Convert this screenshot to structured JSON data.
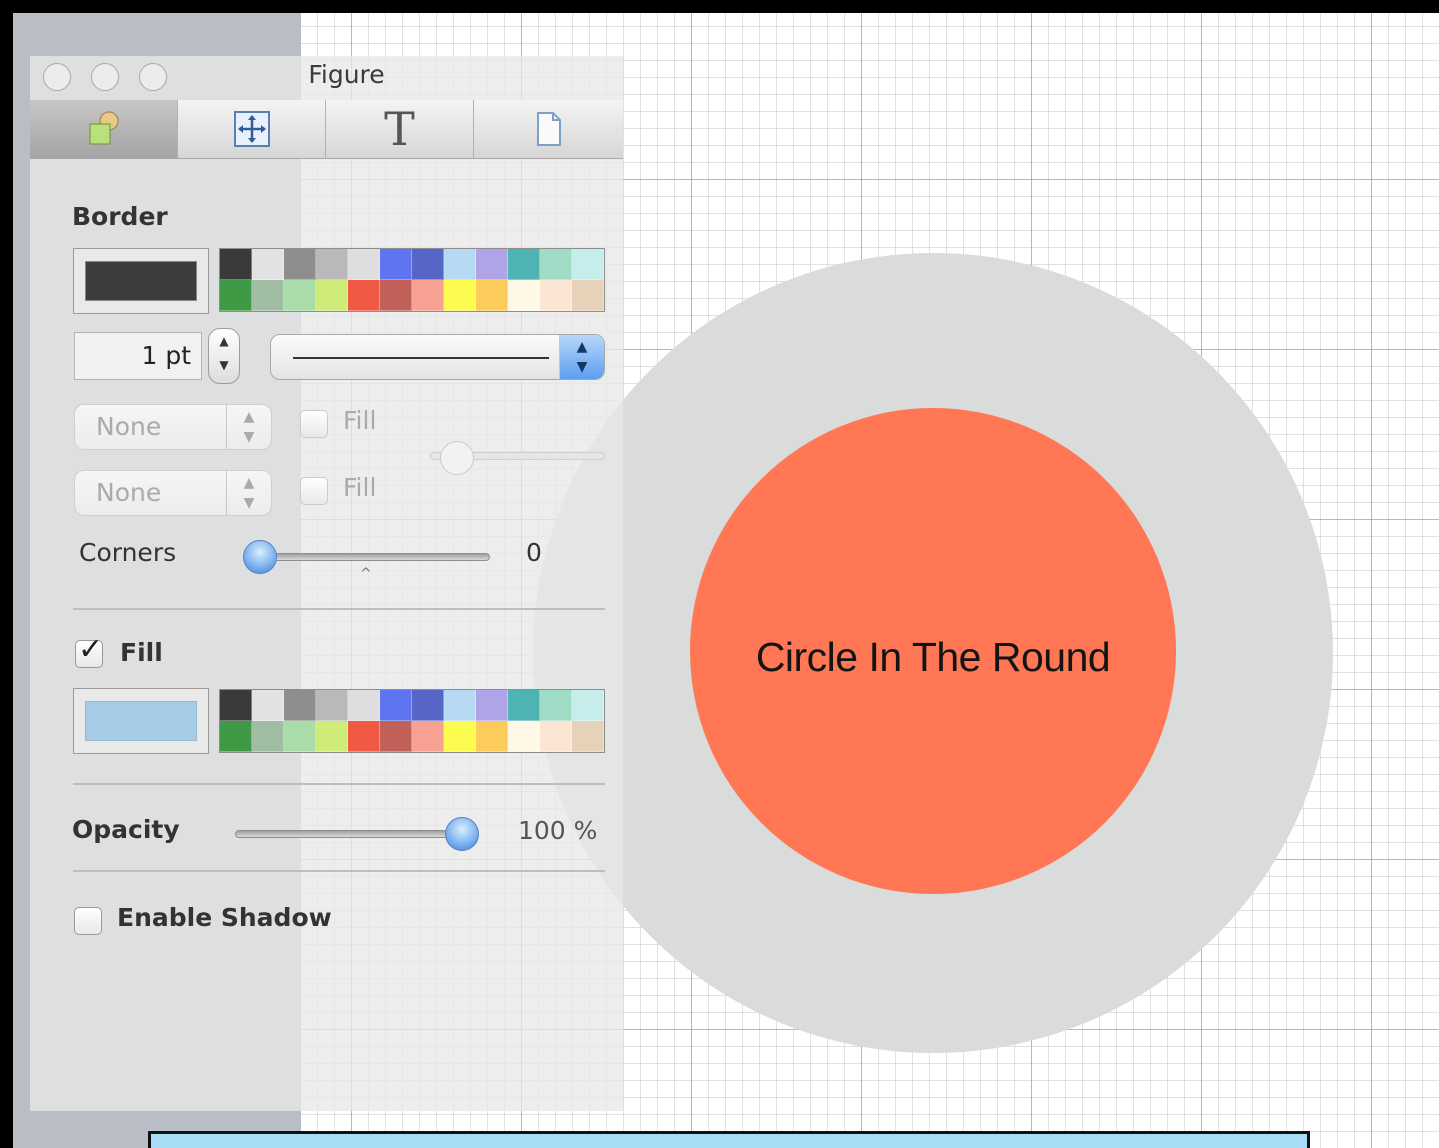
{
  "window": {
    "title": "Figure"
  },
  "tabs": [
    {
      "id": "style",
      "icon": "shapes-style-icon"
    },
    {
      "id": "geometry",
      "icon": "move-arrows-icon"
    },
    {
      "id": "text",
      "glyph": "T",
      "icon": "text-icon"
    },
    {
      "id": "document",
      "icon": "document-icon"
    }
  ],
  "border": {
    "label": "Border",
    "color": "#3d3d40",
    "width_value": "1 pt",
    "line_style": "solid",
    "start_arrow": {
      "value": "None",
      "fill_label": "Fill"
    },
    "end_arrow": {
      "value": "None",
      "fill_label": "Fill"
    }
  },
  "corners": {
    "label": "Corners",
    "value": "0"
  },
  "fill": {
    "label": "Fill",
    "checked": true,
    "color": "#a5cce6"
  },
  "opacity": {
    "label": "Opacity",
    "value": "100 %",
    "level": 1.0
  },
  "shadow": {
    "label": "Enable Shadow",
    "checked": false
  },
  "palette": [
    "#3a3a3a",
    "#e2e2e2",
    "#8e8e8e",
    "#b9b9b9",
    "#dedede",
    "#5f74f0",
    "#5766c6",
    "#b7d9f3",
    "#b1a3e8",
    "#4db3b3",
    "#a0dcc5",
    "#c7ecec",
    "#3f9a46",
    "#a0bca3",
    "#a8dca8",
    "#cfec79",
    "#f05a45",
    "#c1615a",
    "#f6a191",
    "#fbfb50",
    "#fbcb5b",
    "#fdf9e6",
    "#fbe6d3",
    "#e5d2b9"
  ],
  "figure": {
    "label": "Circle In The Round",
    "outer_color": "#dadbdb",
    "inner_color": "#ff7755"
  }
}
